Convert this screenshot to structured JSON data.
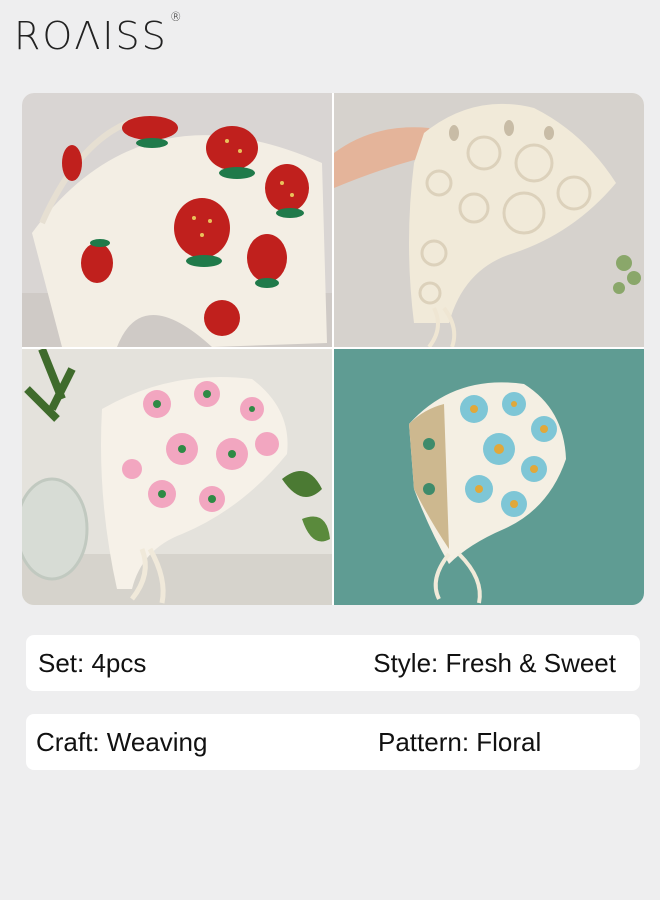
{
  "brand": {
    "name": "ROΛISS",
    "mark": "®"
  },
  "images": [
    {
      "icon": "strawberry-headscarf-image",
      "bg": "#d9d5d3"
    },
    {
      "icon": "cream-lace-headscarf-image",
      "bg": "#d6d2cd"
    },
    {
      "icon": "pink-flower-headscarf-image",
      "bg": "#e4e2dc"
    },
    {
      "icon": "blue-flower-headscarf-image",
      "bg": "#5f9c93"
    }
  ],
  "specs": {
    "set": "Set:  4pcs",
    "style": "Style: Fresh & Sweet",
    "craft": "Craft: Weaving",
    "pattern": "Pattern: Floral"
  }
}
